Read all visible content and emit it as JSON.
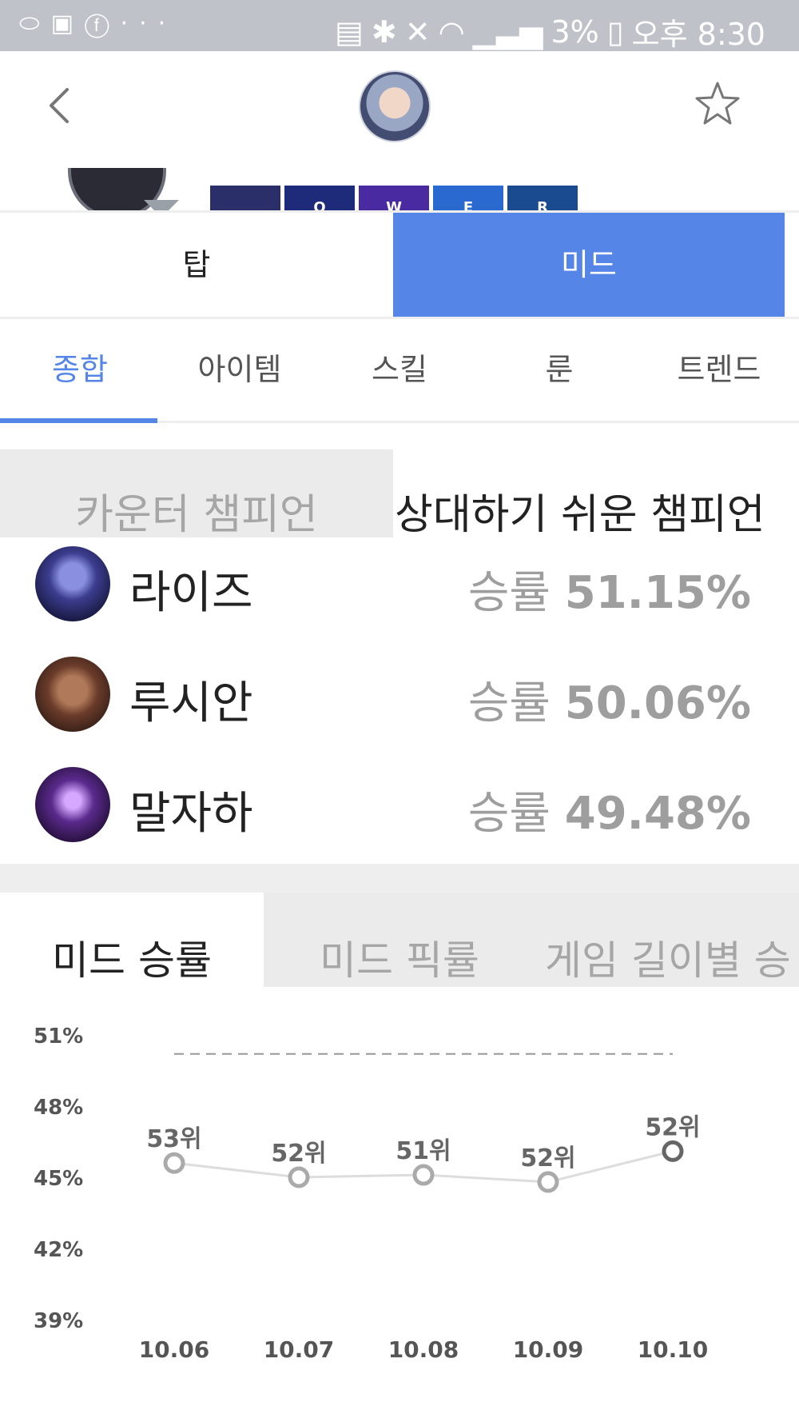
{
  "status_bar": {
    "left_icons": [
      "pill-icon",
      "image-icon",
      "facebook-icon",
      "more-icon"
    ],
    "battery": "3%",
    "time": "오후 8:30"
  },
  "header": {
    "champion_skills": [
      "Q",
      "W",
      "E",
      "R"
    ]
  },
  "position_tabs": [
    "탑",
    "미드"
  ],
  "active_position": "미드",
  "sub_tabs": [
    "종합",
    "아이템",
    "스킬",
    "룬",
    "트렌드"
  ],
  "matchup_tabs": {
    "counter": "카운터 챔피언",
    "easy": "상대하기 쉬운 챔피언"
  },
  "matchups": [
    {
      "name": "라이즈",
      "rate_label": "승률",
      "rate": "51.15%",
      "color": "#3c3d8f"
    },
    {
      "name": "루시안",
      "rate_label": "승률",
      "rate": "50.06%",
      "color": "#6b3b2a"
    },
    {
      "name": "말자하",
      "rate_label": "승률",
      "rate": "49.48%",
      "color": "#5a2a8c"
    }
  ],
  "stat_tabs": [
    "미드 승률",
    "미드 픽률",
    "게임 길이별 승"
  ],
  "chart_data": {
    "type": "line",
    "categories": [
      "10.06",
      "10.07",
      "10.08",
      "10.09",
      "10.10"
    ],
    "values": [
      45.6,
      45.0,
      45.1,
      44.8,
      46.1
    ],
    "point_labels": [
      "53위",
      "52위",
      "51위",
      "52위",
      "52위"
    ],
    "y_ticks": [
      "51%",
      "48%",
      "45%",
      "42%",
      "39%"
    ],
    "y_tick_values": [
      51,
      48,
      45,
      42,
      39
    ],
    "ylim": [
      39,
      51
    ],
    "reference_line": 50.2
  }
}
